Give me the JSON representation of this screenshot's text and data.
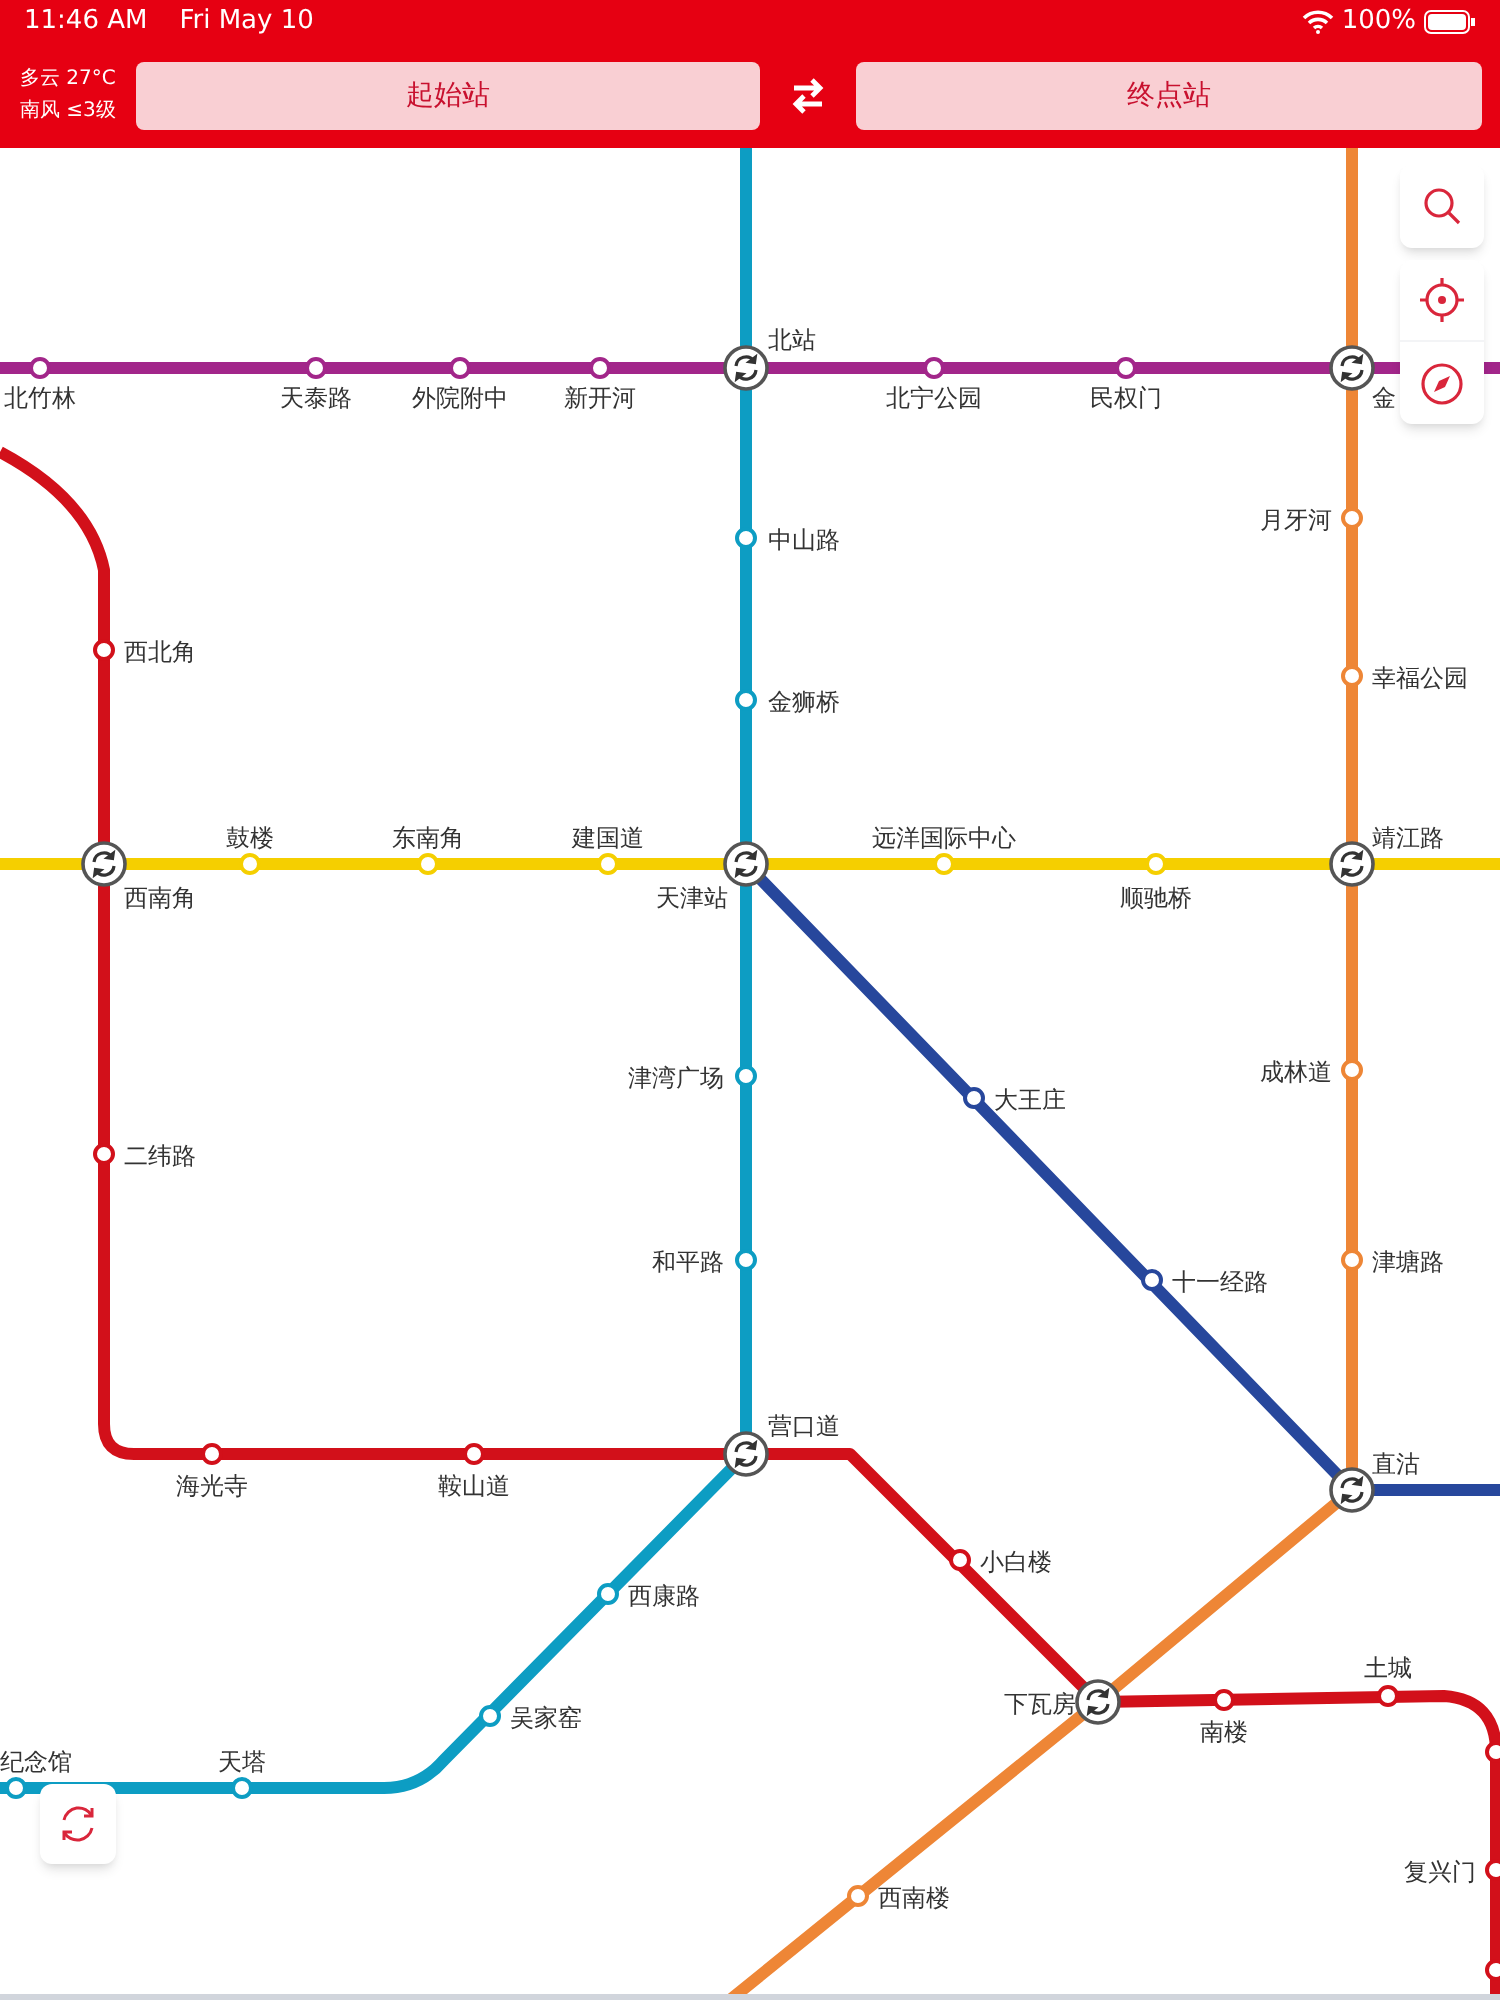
{
  "status_bar": {
    "time": "11:46 AM",
    "date": "Fri May 10",
    "battery": "100%"
  },
  "header": {
    "weather": "多云 27°C",
    "wind": "南风 ≤3级",
    "start_button": "起始站",
    "end_button": "终点站"
  },
  "map": {
    "lines": [
      {
        "color": "#a2268a",
        "stations": [
          {
            "name": "北竹林",
            "kind": "station"
          },
          {
            "name": "天泰路",
            "kind": "station"
          },
          {
            "name": "外院附中",
            "kind": "station"
          },
          {
            "name": "新开河",
            "kind": "station"
          },
          {
            "name": "北站",
            "kind": "transfer"
          },
          {
            "name": "北宁公园",
            "kind": "station"
          },
          {
            "name": "民权门",
            "kind": "station"
          },
          {
            "name": "金",
            "kind": "transfer"
          }
        ]
      },
      {
        "color": "#0d9dc3",
        "stations": [
          {
            "name": "中山路",
            "kind": "station"
          },
          {
            "name": "金狮桥",
            "kind": "station"
          },
          {
            "name": "天津站",
            "kind": "transfer"
          },
          {
            "name": "津湾广场",
            "kind": "station"
          },
          {
            "name": "和平路",
            "kind": "station"
          },
          {
            "name": "营口道",
            "kind": "transfer"
          },
          {
            "name": "西康路",
            "kind": "station"
          },
          {
            "name": "吴家窑",
            "kind": "station"
          },
          {
            "name": "天塔",
            "kind": "station"
          },
          {
            "name": "纪念馆",
            "kind": "station"
          }
        ]
      },
      {
        "color": "#f5cf00",
        "stations": [
          {
            "name": "西南角",
            "kind": "transfer"
          },
          {
            "name": "鼓楼",
            "kind": "station"
          },
          {
            "name": "东南角",
            "kind": "station"
          },
          {
            "name": "建国道",
            "kind": "station"
          },
          {
            "name": "远洋国际中心",
            "kind": "station"
          },
          {
            "name": "顺驰桥",
            "kind": "station"
          },
          {
            "name": "靖江路",
            "kind": "transfer"
          }
        ]
      },
      {
        "color": "#d2101a",
        "stations": [
          {
            "name": "西北角",
            "kind": "station"
          },
          {
            "name": "二纬路",
            "kind": "station"
          },
          {
            "name": "海光寺",
            "kind": "station"
          },
          {
            "name": "鞍山道",
            "kind": "station"
          },
          {
            "name": "小白楼",
            "kind": "station"
          },
          {
            "name": "下瓦房",
            "kind": "transfer"
          },
          {
            "name": "南楼",
            "kind": "station"
          },
          {
            "name": "土城",
            "kind": "station"
          },
          {
            "kind": "station"
          },
          {
            "name": "复兴门",
            "kind": "station"
          },
          {
            "kind": "station"
          }
        ]
      },
      {
        "color": "#ee8636",
        "stations": [
          {
            "name": "月牙河",
            "kind": "station"
          },
          {
            "name": "幸福公园",
            "kind": "station"
          },
          {
            "name": "成林道",
            "kind": "station"
          },
          {
            "name": "津塘路",
            "kind": "station"
          },
          {
            "name": "直沽",
            "kind": "transfer"
          },
          {
            "name": "西南楼",
            "kind": "station"
          }
        ]
      },
      {
        "color": "#27479c",
        "stations": [
          {
            "name": "大王庄",
            "kind": "station"
          },
          {
            "name": "十一经路",
            "kind": "station"
          }
        ]
      }
    ]
  }
}
